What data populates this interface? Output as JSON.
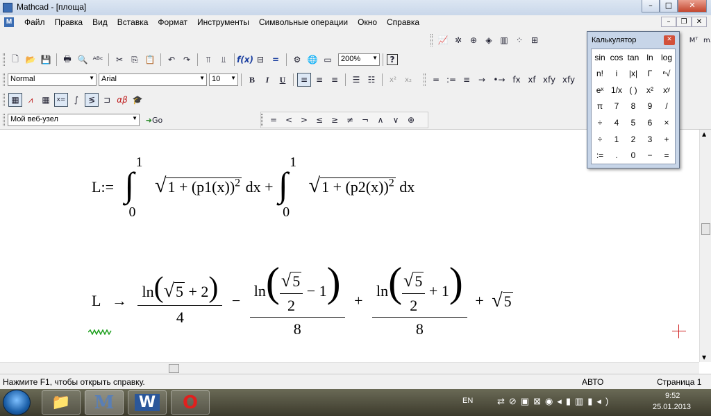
{
  "window": {
    "title": "Mathcad - [площа]"
  },
  "menu": {
    "items": [
      "Файл",
      "Правка",
      "Вид",
      "Вставка",
      "Формат",
      "Инструменты",
      "Символьные операции",
      "Окно",
      "Справка"
    ]
  },
  "toolbar": {
    "zoom": "200%",
    "style": "Normal",
    "font": "Arial",
    "size": "10",
    "web_site": "Мой веб-узел",
    "go_label": "Go",
    "bold": "B",
    "italic": "I",
    "underline": "U",
    "eval_symbols": [
      "=",
      ":=",
      "≡",
      "→",
      "•→",
      "fx",
      "xf",
      "xfy",
      "xfy"
    ],
    "bool_symbols": [
      "=",
      "<",
      ">",
      "≤",
      "≥",
      "≠",
      "¬",
      "∧",
      "∨",
      "⊕"
    ]
  },
  "calculator": {
    "title": "Калькулятор",
    "keys": [
      "sin",
      "cos",
      "tan",
      "ln",
      "log",
      "n!",
      "i",
      "|x|",
      "Γ",
      "ⁿ√",
      "eˣ",
      "1/x",
      "( )",
      "x²",
      "xʸ",
      "π",
      "7",
      "8",
      "9",
      "/",
      "÷",
      "4",
      "5",
      "6",
      "×",
      "÷",
      "1",
      "2",
      "3",
      "+",
      ":=",
      ".",
      "0",
      "−",
      "="
    ]
  },
  "document": {
    "eq1": {
      "lhs": "L",
      "assign": ":=",
      "lower1": "0",
      "upper1": "1",
      "integrand1": "1 + (p1(x))",
      "power": "2",
      "dx": "dx",
      "plus": "+",
      "lower2": "0",
      "upper2": "1",
      "integrand2": "1 + (p2(x))"
    },
    "eq2": {
      "lhs": "L",
      "arrow": "→",
      "ln": "ln",
      "five": "5",
      "two": "2",
      "four": "4",
      "eight": "8",
      "one": "1",
      "minus": "−",
      "plus": "+",
      "sqrt5": "5"
    }
  },
  "status": {
    "help": "Нажмите F1, чтобы открыть справку.",
    "mode": "АВТО",
    "page": "Страница 1"
  },
  "taskbar": {
    "lang": "EN",
    "time": "9:52",
    "date": "25.01.2013"
  }
}
